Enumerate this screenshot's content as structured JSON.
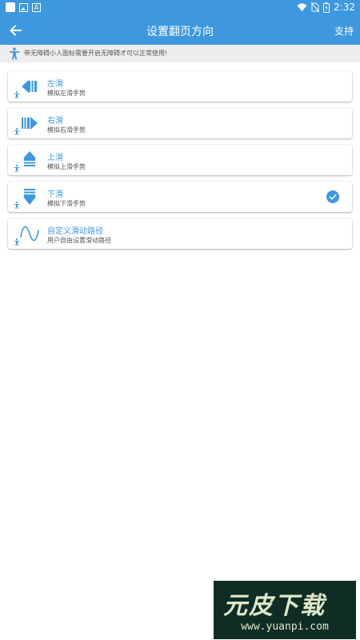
{
  "status_bar": {
    "time": "2:32",
    "app_icons": [
      "square-icon",
      "image-icon",
      "a-icon"
    ],
    "system_icons": [
      "wifi-icon",
      "no-sim-icon",
      "battery-icon"
    ]
  },
  "header": {
    "title": "设置翻页方向",
    "support_label": "支持",
    "back_icon": "arrow-left-icon"
  },
  "notice": {
    "text": "带无障碍小人图标需要开启无障碍才可以正常使用!"
  },
  "options": [
    {
      "title": "左滑",
      "subtitle": "模拟左滑手势",
      "icon": "swipe-left-icon",
      "selected": false
    },
    {
      "title": "右滑",
      "subtitle": "模拟右滑手势",
      "icon": "swipe-right-icon",
      "selected": false
    },
    {
      "title": "上滑",
      "subtitle": "模拟上滑手势",
      "icon": "swipe-up-icon",
      "selected": false
    },
    {
      "title": "下滑",
      "subtitle": "模拟下滑手势",
      "icon": "swipe-down-icon",
      "selected": true
    },
    {
      "title": "自定义滑动路径",
      "subtitle": "用户自由设置滑动路径",
      "icon": "custom-path-icon",
      "selected": false
    }
  ],
  "watermark": {
    "brand": "元皮下载",
    "url": "www.yuanpi.com"
  },
  "colors": {
    "primary": "#3d98df",
    "notice_bg": "#eeeeee"
  }
}
